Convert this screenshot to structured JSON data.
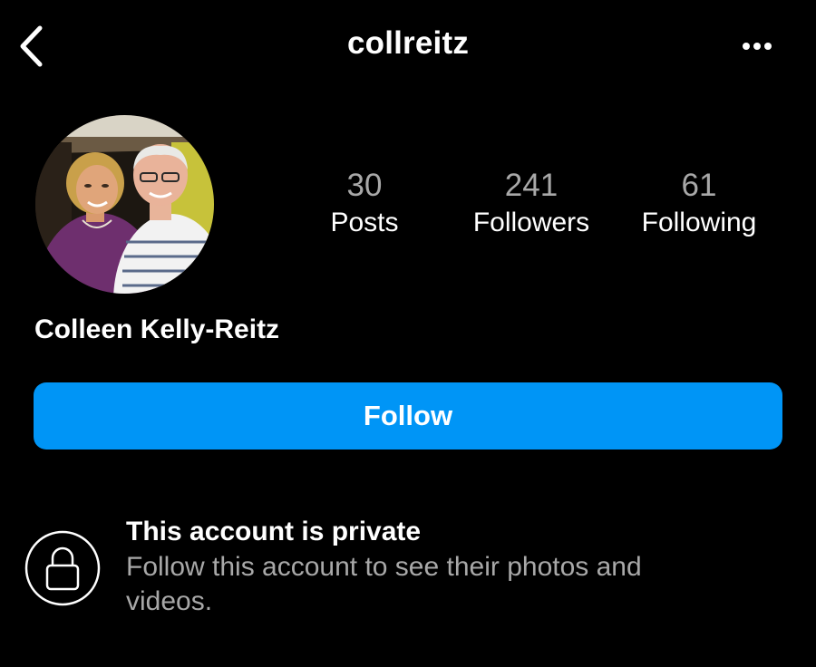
{
  "header": {
    "username": "collreitz",
    "back_icon": "chevron-left-icon",
    "more_icon": "more-horizontal-icon"
  },
  "profile": {
    "full_name": "Colleen Kelly-Reitz",
    "avatar_icon": "profile-photo"
  },
  "stats": {
    "posts": {
      "value": "30",
      "label": "Posts"
    },
    "followers": {
      "value": "241",
      "label": "Followers"
    },
    "following": {
      "value": "61",
      "label": "Following"
    }
  },
  "actions": {
    "follow_label": "Follow"
  },
  "private_notice": {
    "icon": "lock-icon",
    "title": "This account is private",
    "subtitle": "Follow this account to see their photos and videos."
  },
  "colors": {
    "background": "#000000",
    "accent": "#0095f6",
    "secondary_text": "#a8a8a8"
  }
}
